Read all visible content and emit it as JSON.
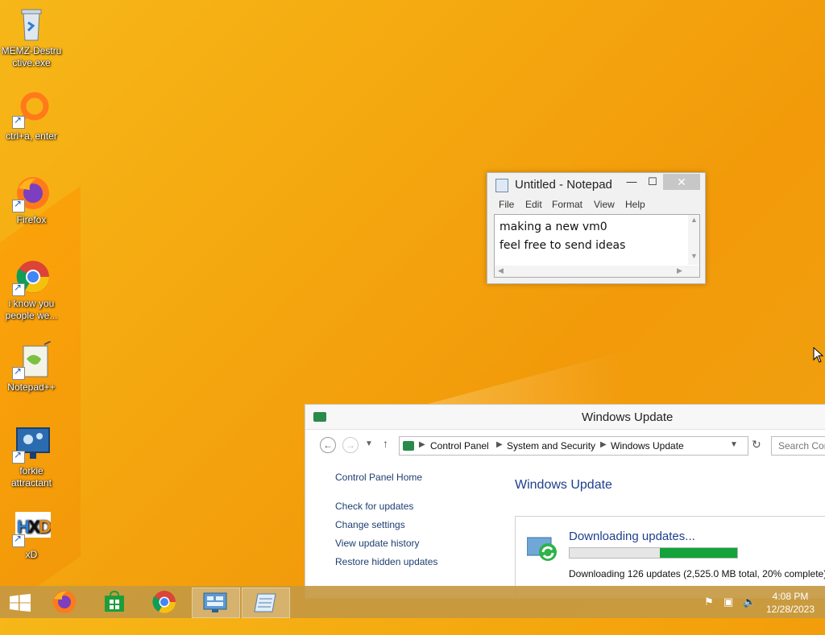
{
  "desktop": {
    "icons": [
      {
        "label": "MEMZ-Destructive.exe",
        "lines": [
          "MEMZ-Destru",
          "ctive.exe"
        ],
        "icon": "recycle-bin-icon"
      },
      {
        "label": "ctrl+a, enter",
        "lines": [
          "ctrl+a, enter"
        ],
        "icon": "orange-ring-icon"
      },
      {
        "label": "Firefox",
        "lines": [
          "Firefox"
        ],
        "icon": "firefox-icon"
      },
      {
        "label": "i know you people we...",
        "lines": [
          "i know you",
          "people we..."
        ],
        "icon": "chrome-icon"
      },
      {
        "label": "Notepad++",
        "lines": [
          "Notepad++"
        ],
        "icon": "notepadpp-icon"
      },
      {
        "label": "forkie attractant",
        "lines": [
          "forkie",
          "attractant"
        ],
        "icon": "settings-monitor-icon"
      },
      {
        "label": "xD",
        "lines": [
          "xD"
        ],
        "icon": "hxd-icon"
      }
    ]
  },
  "notepad": {
    "title": "Untitled - Notepad",
    "menu": [
      "File",
      "Edit",
      "Format",
      "View",
      "Help"
    ],
    "lines": [
      "making a new vm0",
      "feel free to send ideas"
    ]
  },
  "windows_update": {
    "title": "Windows Update",
    "breadcrumb": [
      "Control Panel",
      "System and Security",
      "Windows Update"
    ],
    "search_placeholder": "Search Control Panel",
    "search_visible": "Search Con",
    "left_links": [
      "Control Panel Home",
      "Check for updates",
      "Change settings",
      "View update history",
      "Restore hidden updates"
    ],
    "heading": "Windows Update",
    "panel_title": "Downloading updates...",
    "progress_fraction": 0.5,
    "status": "Downloading 126 updates (2,525.0 MB total, 20% complete)"
  },
  "taskbar": {
    "items": [
      "start-icon",
      "firefox-icon",
      "store-icon",
      "chrome-icon",
      "control-panel-icon",
      "notepad-icon"
    ],
    "time": "4:08 PM",
    "date": "12/28/2023",
    "colors": {
      "desktop": "#f4a80f",
      "progress": "#13a33a",
      "link": "#1c3f72",
      "heading": "#1e3f8c"
    }
  }
}
